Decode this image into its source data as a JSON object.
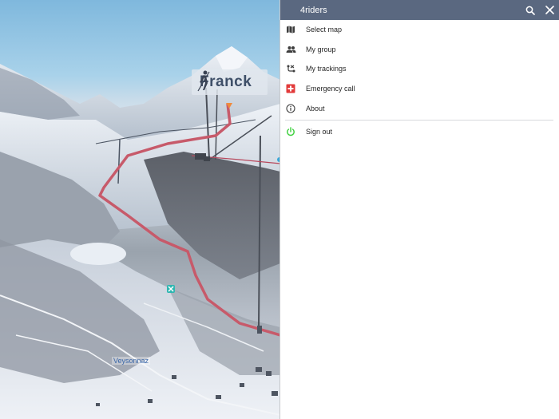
{
  "map": {
    "player_name": "Franck",
    "town_label": "Veysonnaz"
  },
  "drawer": {
    "title": "4riders",
    "header_color": "#5a6880",
    "search_icon": "search-icon",
    "close_icon": "close-icon",
    "items": [
      {
        "label": "Select map",
        "icon": "map-icon"
      },
      {
        "label": "My group",
        "icon": "group-icon"
      },
      {
        "label": "My trackings",
        "icon": "tracking-icon"
      },
      {
        "label": "Emergency call",
        "icon": "swiss-cross-icon",
        "icon_color": "#e23a3a"
      },
      {
        "label": "About",
        "icon": "info-icon"
      }
    ],
    "sign_out": {
      "label": "Sign out",
      "icon": "power-icon",
      "icon_color": "#3ccf3c"
    }
  }
}
